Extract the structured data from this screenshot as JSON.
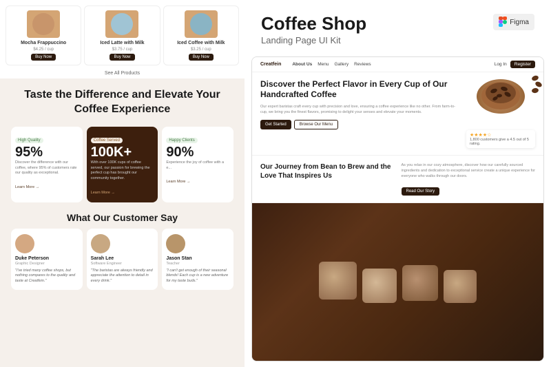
{
  "left_panel": {
    "products": [
      {
        "name": "Mocha Frappuccino",
        "price": "$4.25 / cup",
        "buy_label": "Buy Now"
      },
      {
        "name": "Iced Latte with Milk",
        "price": "$3.75 / cup",
        "buy_label": "Buy Now"
      },
      {
        "name": "Iced Coffee with Milk",
        "price": "$3.25 / cup",
        "buy_label": "Buy Now"
      }
    ],
    "see_all": "See All Products",
    "headline": "Taste the Difference and Elevate Your Coffee Experience",
    "stats": [
      {
        "badge": "High Quality",
        "badge_type": "green",
        "number": "95%",
        "description": "Discover the difference with our coffee, where 95% of customers rate our quality as exceptional.",
        "link": "Learn More →"
      },
      {
        "badge": "Coffee Served",
        "badge_type": "coffee",
        "number": "100K+",
        "description": "With over 100K cups of coffee served, our passion for brewing the perfect cup has brought our community together.",
        "link": "Learn More →",
        "dark": true
      },
      {
        "badge": "Happy Clients",
        "badge_type": "green",
        "number": "90%",
        "description": "Experience the joy of coffee with a e...",
        "link": "Learn More →"
      }
    ],
    "customer_section": {
      "title": "What Our Customer Say",
      "customers": [
        {
          "name": "Duke Peterson",
          "role": "Graphic Designer",
          "review": "\"I've tried many coffee shops, but nothing compares to the quality and taste at Creatfein.\""
        },
        {
          "name": "Sarah Lee",
          "role": "Software Engineer",
          "review": "\"The baristas are always friendly and appreciate the attention to detail in every drink.\""
        },
        {
          "name": "Jason Stan",
          "role": "Teacher",
          "review": "\"I can't get enough of their seasonal blends! Each cup is a new adventure for my taste buds.\""
        }
      ]
    }
  },
  "right_panel": {
    "title": "Coffee Shop",
    "subtitle": "Landing Page UI Kit",
    "figma_label": "Figma",
    "navbar": {
      "logo": "Creatfein",
      "links": [
        "About Us",
        "Menu",
        "Gallery",
        "Reviews"
      ],
      "login": "Log In",
      "register": "Register"
    },
    "hero": {
      "title": "Discover the Perfect Flavor in Every Cup of Our Handcrafted Coffee",
      "description": "Our expert baristas craft every cup with precision and love, ensuring a coffee experience like no other. From farm-to-cup, we bring you the finest flavors, promising to delight your senses and elevate your moments.",
      "btn_primary": "Get Started",
      "btn_secondary": "Browse Our Menu",
      "rating_stars": "★★★★☆",
      "rating_text": "1,800 customers give a 4.5 out of 5 rating."
    },
    "journey": {
      "title": "Our Journey from Bean to Brew and the Love That Inspires Us",
      "description": "As you relax in our cozy atmosphere, discover how our carefully sourced ingredients and dedication to exceptional service create a unique experience for everyone who walks through our doors.",
      "btn_label": "Read Our Story"
    }
  }
}
